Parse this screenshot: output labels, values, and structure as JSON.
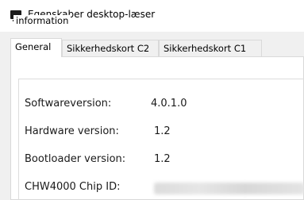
{
  "window": {
    "title": "Egenskaber desktop-læser",
    "icon": "monitor-icon"
  },
  "tabs": [
    {
      "label": "General",
      "selected": true
    },
    {
      "label": "Sikkerhedskort C2",
      "selected": false
    },
    {
      "label": "Sikkerhedskort C1",
      "selected": false
    }
  ],
  "information": {
    "legend": "information",
    "rows": [
      {
        "label": "Softwareversion:",
        "value": "4.0.1.0"
      },
      {
        "label": "Hardware version:",
        "value": "1.2"
      },
      {
        "label": "Bootloader version:",
        "value": "1.2"
      },
      {
        "label": "CHW4000 Chip ID:",
        "value": ""
      }
    ]
  }
}
